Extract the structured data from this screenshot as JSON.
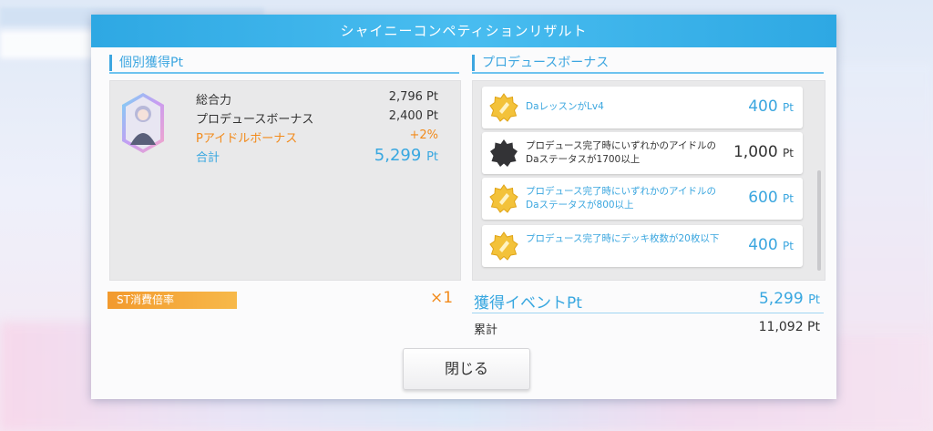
{
  "dialog": {
    "title": "シャイニーコンペティションリザルト"
  },
  "individual": {
    "section_title": "個別獲得Pt",
    "rows": [
      {
        "label": "総合力",
        "value": "2,796 Pt"
      },
      {
        "label": "プロデュースボーナス",
        "value": "2,400 Pt"
      },
      {
        "label": "Pアイドルボーナス",
        "value": "+2%"
      }
    ],
    "total": {
      "label": "合計",
      "value": "5,299",
      "unit": "Pt"
    }
  },
  "bonus": {
    "section_title": "プロデュースボーナス",
    "items": [
      {
        "desc": "DaレッスンがLv4",
        "value": "400",
        "unit": "Pt",
        "achieved": true
      },
      {
        "desc": "プロデュース完了時にいずれかのアイドルのDaステータスが1700以上",
        "value": "1,000",
        "unit": "Pt",
        "achieved": false
      },
      {
        "desc": "プロデュース完了時にいずれかのアイドルのDaステータスが800以上",
        "value": "600",
        "unit": "Pt",
        "achieved": true
      },
      {
        "desc": "プロデュース完了時にデッキ枚数が20枚以下",
        "value": "400",
        "unit": "Pt",
        "achieved": true
      }
    ]
  },
  "st": {
    "label": "ST消費倍率",
    "multiplier": "×1"
  },
  "event": {
    "label": "獲得イベントPt",
    "value": "5,299",
    "unit": "Pt"
  },
  "cumulative": {
    "label": "累計",
    "value": "11,092 Pt"
  },
  "close_button": "閉じる",
  "colors": {
    "accent": "#38a7e0",
    "orange": "#f28a1a",
    "header": "#2ea8e3"
  }
}
